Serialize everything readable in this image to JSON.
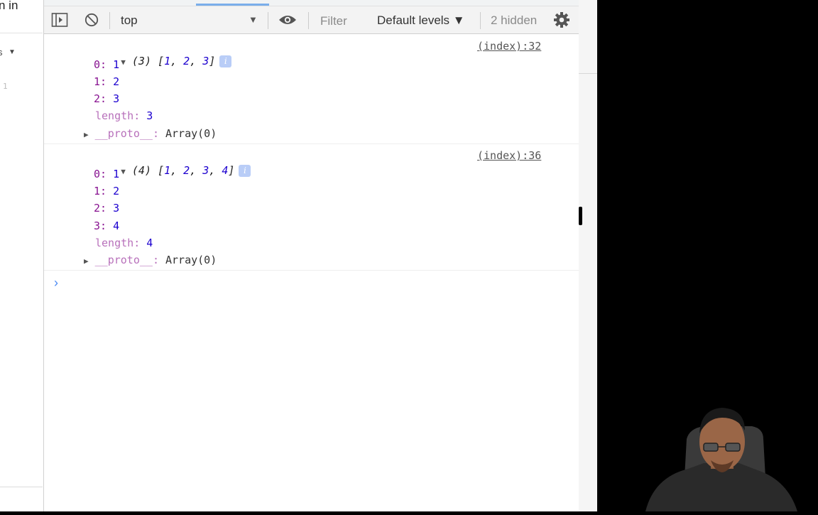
{
  "left_panel": {
    "sign_text": "n in",
    "arrow_text": "s",
    "line_number": "1"
  },
  "toolbar": {
    "context": "top",
    "filter_placeholder": "Filter",
    "levels_label": "Default levels ▼",
    "hidden_label": "2 hidden"
  },
  "console": {
    "entries": [
      {
        "summary_prefix": "(3) [",
        "summary_values": [
          "1",
          "2",
          "3"
        ],
        "source": "(index):32",
        "props": [
          {
            "key": "0",
            "value": "1"
          },
          {
            "key": "1",
            "value": "2"
          },
          {
            "key": "2",
            "value": "3"
          }
        ],
        "length_key": "length",
        "length_value": "3",
        "proto_key": "__proto__",
        "proto_value": "Array(0)"
      },
      {
        "summary_prefix": "(4) [",
        "summary_values": [
          "1",
          "2",
          "3",
          "4"
        ],
        "source": "(index):36",
        "props": [
          {
            "key": "0",
            "value": "1"
          },
          {
            "key": "1",
            "value": "2"
          },
          {
            "key": "2",
            "value": "3"
          },
          {
            "key": "3",
            "value": "4"
          }
        ],
        "length_key": "length",
        "length_value": "4",
        "proto_key": "__proto__",
        "proto_value": "Array(0)"
      }
    ],
    "prompt": "›"
  },
  "colors": {
    "accent": "#4a8af4",
    "key": "#881391",
    "value": "#1c00cf"
  }
}
